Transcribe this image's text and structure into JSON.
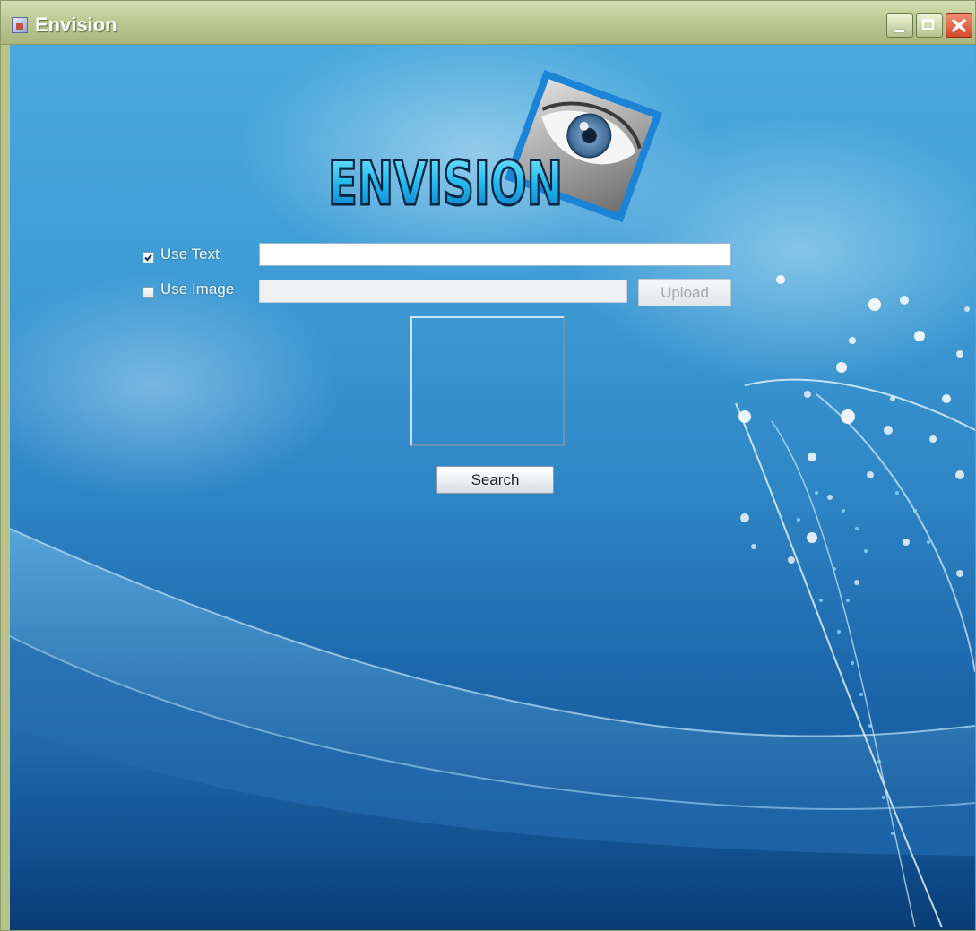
{
  "window": {
    "title": "Envision",
    "controls": {
      "minimize": "minimize-icon",
      "maximize": "maximize-icon",
      "close": "close-icon"
    }
  },
  "logo": {
    "text": "ENVISION"
  },
  "form": {
    "use_text": {
      "label": "Use Text",
      "checked": true,
      "value": ""
    },
    "use_image": {
      "label": "Use Image",
      "checked": false,
      "value": ""
    },
    "upload_label": "Upload",
    "search_label": "Search"
  },
  "colors": {
    "titlebar": "#bdc994",
    "background_top": "#4aa9dc",
    "background_bottom": "#0f4f92",
    "close_button": "#d44a2b"
  }
}
